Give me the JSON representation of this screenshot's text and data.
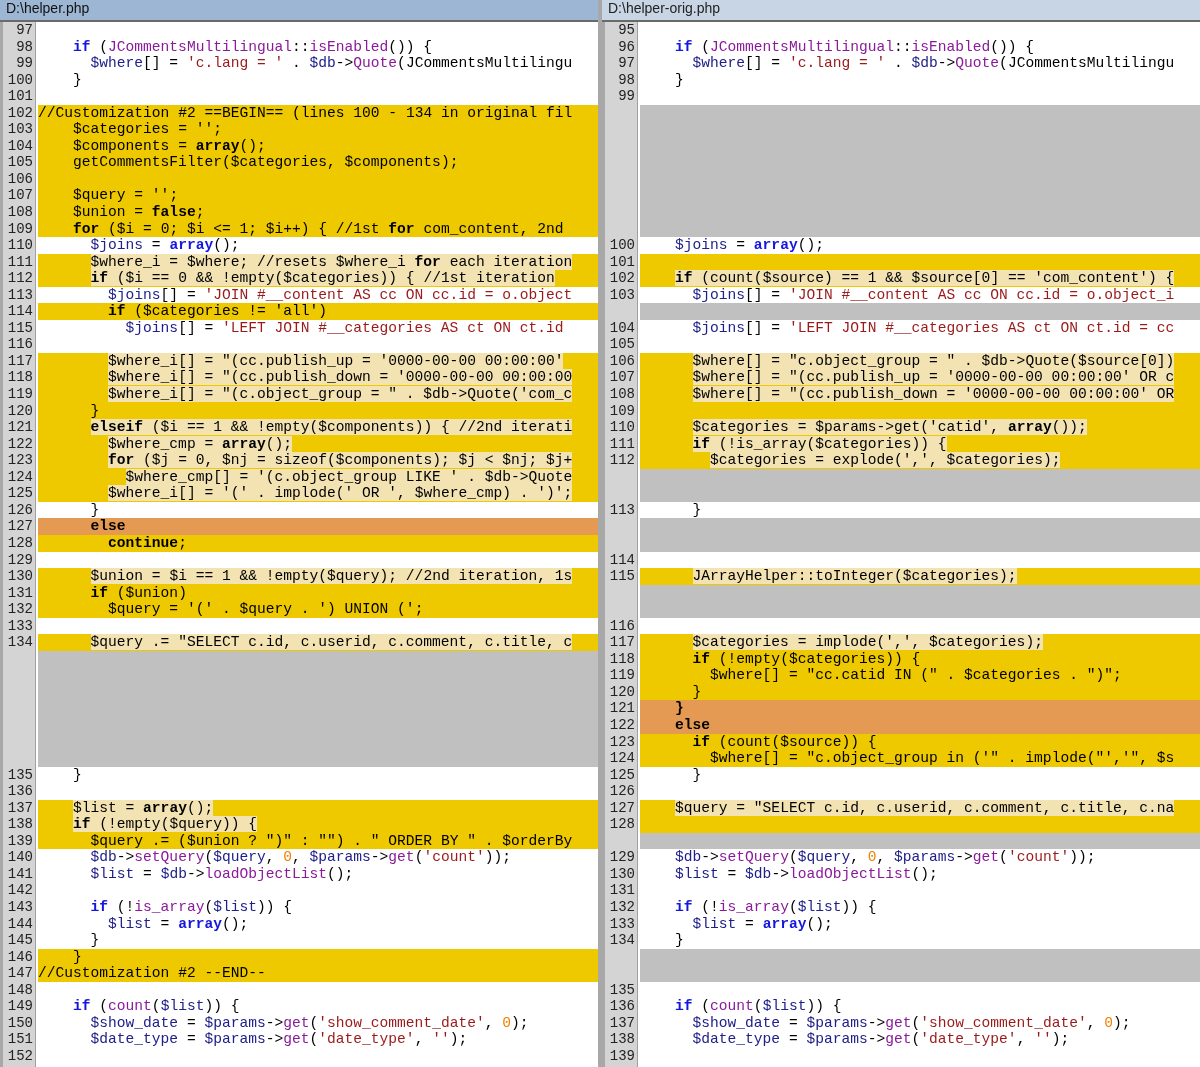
{
  "panes": [
    {
      "title": "D:\\helper.php",
      "active": true,
      "rows": [
        {
          "number": "97",
          "kind": "same"
        },
        {
          "number": "98",
          "kind": "same",
          "text": "    if (JCommentsMultilingual::isEnabled()) {"
        },
        {
          "number": "99",
          "kind": "same",
          "text": "      $where[] = 'c.lang = ' . $db->Quote(JCommentsMultilingu"
        },
        {
          "number": "100",
          "kind": "same",
          "text": "    }"
        },
        {
          "number": "101",
          "kind": "same"
        },
        {
          "number": "102",
          "kind": "changed",
          "text": "//Customization #2 ==BEGIN== (lines 100 - 134 in original fil"
        },
        {
          "number": "103",
          "kind": "changed",
          "text": "    $categories = '';"
        },
        {
          "number": "104",
          "kind": "changed",
          "text": "    $components = array();"
        },
        {
          "number": "105",
          "kind": "changed",
          "text": "    getCommentsFilter($categories, $components);"
        },
        {
          "number": "106",
          "kind": "changed"
        },
        {
          "number": "107",
          "kind": "changed",
          "text": "    $query = '';"
        },
        {
          "number": "108",
          "kind": "changed",
          "text": "    $union = false;"
        },
        {
          "number": "109",
          "kind": "changed",
          "text": "    for ($i = 0; $i <= 1; $i++) { //1st for com_content, 2nd"
        },
        {
          "number": "110",
          "kind": "same",
          "text": "      $joins = array();"
        },
        {
          "number": "111",
          "kind": "changed",
          "marked": true,
          "text": "      $where_i = $where; //resets $where_i for each iteration"
        },
        {
          "number": "112",
          "kind": "changed",
          "marked": true,
          "text": "      if ($i == 0 && !empty($categories)) { //1st iteration"
        },
        {
          "number": "113",
          "kind": "same",
          "text": "        $joins[] = 'JOIN #__content AS cc ON cc.id = o.object"
        },
        {
          "number": "114",
          "kind": "changed",
          "text": "        if ($categories != 'all')"
        },
        {
          "number": "115",
          "kind": "same",
          "text": "          $joins[] = 'LEFT JOIN #__categories AS ct ON ct.id"
        },
        {
          "number": "116",
          "kind": "same"
        },
        {
          "number": "117",
          "kind": "changed",
          "marked": true,
          "text": "        $where_i[] = \"(cc.publish_up = '0000-00-00 00:00:00'"
        },
        {
          "number": "118",
          "kind": "changed",
          "marked": true,
          "text": "        $where_i[] = \"(cc.publish_down = '0000-00-00 00:00:00"
        },
        {
          "number": "119",
          "kind": "changed",
          "marked": true,
          "text": "        $where_i[] = \"(c.object_group = \" . $db->Quote('com_c"
        },
        {
          "number": "120",
          "kind": "changed",
          "text": "      }"
        },
        {
          "number": "121",
          "kind": "changed",
          "marked": true,
          "text": "      elseif ($i == 1 && !empty($components)) { //2nd iterati"
        },
        {
          "number": "122",
          "kind": "changed",
          "marked": true,
          "text": "        $where_cmp = array();"
        },
        {
          "number": "123",
          "kind": "changed",
          "marked": true,
          "text": "        for ($j = 0, $nj = sizeof($components); $j < $nj; $j+"
        },
        {
          "number": "124",
          "kind": "changed",
          "marked": true,
          "text": "          $where_cmp[] = '(c.object_group LIKE ' . $db->Quote"
        },
        {
          "number": "125",
          "kind": "changed",
          "marked": true,
          "text": "        $where_i[] = '(' . implode(' OR ', $where_cmp) . ')';"
        },
        {
          "number": "126",
          "kind": "same",
          "text": "      }"
        },
        {
          "number": "127",
          "kind": "conflict",
          "text": "      else"
        },
        {
          "number": "128",
          "kind": "changed",
          "text": "        continue;"
        },
        {
          "number": "129",
          "kind": "same"
        },
        {
          "number": "130",
          "kind": "changed",
          "marked": true,
          "text": "      $union = $i == 1 && !empty($query); //2nd iteration, 1s"
        },
        {
          "number": "131",
          "kind": "changed",
          "text": "      if ($union)"
        },
        {
          "number": "132",
          "kind": "changed",
          "text": "        $query = '(' . $query . ') UNION (';"
        },
        {
          "number": "133",
          "kind": "same"
        },
        {
          "number": "134",
          "kind": "changed",
          "marked": true,
          "text": "      $query .= \"SELECT c.id, c.userid, c.comment, c.title, c"
        },
        {
          "kind": "filler"
        },
        {
          "kind": "filler"
        },
        {
          "kind": "filler"
        },
        {
          "kind": "filler"
        },
        {
          "kind": "filler"
        },
        {
          "kind": "filler"
        },
        {
          "kind": "filler"
        },
        {
          "number": "135",
          "kind": "same",
          "text": "    }"
        },
        {
          "number": "136",
          "kind": "same"
        },
        {
          "number": "137",
          "kind": "changed",
          "marked": true,
          "text": "    $list = array();"
        },
        {
          "number": "138",
          "kind": "changed",
          "marked": true,
          "text": "    if (!empty($query)) {"
        },
        {
          "number": "139",
          "kind": "changed",
          "text": "      $query .= ($union ? \")\" : \"\") . \" ORDER BY \" . $orderBy"
        },
        {
          "number": "140",
          "kind": "same",
          "text": "      $db->setQuery($query, 0, $params->get('count'));"
        },
        {
          "number": "141",
          "kind": "same",
          "text": "      $list = $db->loadObjectList();"
        },
        {
          "number": "142",
          "kind": "same"
        },
        {
          "number": "143",
          "kind": "same",
          "text": "      if (!is_array($list)) {"
        },
        {
          "number": "144",
          "kind": "same",
          "text": "        $list = array();"
        },
        {
          "number": "145",
          "kind": "same",
          "text": "      }"
        },
        {
          "number": "146",
          "kind": "changed",
          "text": "    }"
        },
        {
          "number": "147",
          "kind": "changed",
          "text": "//Customization #2 --END--"
        },
        {
          "number": "148",
          "kind": "same"
        },
        {
          "number": "149",
          "kind": "same",
          "text": "    if (count($list)) {"
        },
        {
          "number": "150",
          "kind": "same",
          "text": "      $show_date = $params->get('show_comment_date', 0);"
        },
        {
          "number": "151",
          "kind": "same",
          "text": "      $date_type = $params->get('date_type', '');"
        },
        {
          "number": "152",
          "kind": "same"
        }
      ]
    },
    {
      "title": "D:\\helper-orig.php",
      "active": false,
      "rows": [
        {
          "number": "95",
          "kind": "same"
        },
        {
          "number": "96",
          "kind": "same",
          "text": "    if (JCommentsMultilingual::isEnabled()) {"
        },
        {
          "number": "97",
          "kind": "same",
          "text": "      $where[] = 'c.lang = ' . $db->Quote(JCommentsMultilingu"
        },
        {
          "number": "98",
          "kind": "same",
          "text": "    }"
        },
        {
          "number": "99",
          "kind": "same"
        },
        {
          "kind": "filler"
        },
        {
          "kind": "filler"
        },
        {
          "kind": "filler"
        },
        {
          "kind": "filler"
        },
        {
          "kind": "filler"
        },
        {
          "kind": "filler"
        },
        {
          "kind": "filler"
        },
        {
          "kind": "filler"
        },
        {
          "number": "100",
          "kind": "same",
          "text": "    $joins = array();"
        },
        {
          "number": "101",
          "kind": "changed"
        },
        {
          "number": "102",
          "kind": "changed",
          "marked": true,
          "text": "    if (count($source) == 1 && $source[0] == 'com_content') {"
        },
        {
          "number": "103",
          "kind": "same",
          "text": "      $joins[] = 'JOIN #__content AS cc ON cc.id = o.object_i"
        },
        {
          "kind": "filler"
        },
        {
          "number": "104",
          "kind": "same",
          "text": "      $joins[] = 'LEFT JOIN #__categories AS ct ON ct.id = cc"
        },
        {
          "number": "105",
          "kind": "same"
        },
        {
          "number": "106",
          "kind": "changed",
          "marked": true,
          "text": "      $where[] = \"c.object_group = \" . $db->Quote($source[0])"
        },
        {
          "number": "107",
          "kind": "changed",
          "marked": true,
          "text": "      $where[] = \"(cc.publish_up = '0000-00-00 00:00:00' OR c"
        },
        {
          "number": "108",
          "kind": "changed",
          "marked": true,
          "text": "      $where[] = \"(cc.publish_down = '0000-00-00 00:00:00' OR"
        },
        {
          "number": "109",
          "kind": "changed"
        },
        {
          "number": "110",
          "kind": "changed",
          "marked": true,
          "text": "      $categories = $params->get('catid', array());"
        },
        {
          "number": "111",
          "kind": "changed",
          "marked": true,
          "text": "      if (!is_array($categories)) {"
        },
        {
          "number": "112",
          "kind": "changed",
          "marked": true,
          "text": "        $categories = explode(',', $categories);"
        },
        {
          "kind": "filler"
        },
        {
          "kind": "filler"
        },
        {
          "number": "113",
          "kind": "same",
          "text": "      }"
        },
        {
          "kind": "filler"
        },
        {
          "kind": "filler"
        },
        {
          "number": "114",
          "kind": "same"
        },
        {
          "number": "115",
          "kind": "changed",
          "marked": true,
          "text": "      JArrayHelper::toInteger($categories);"
        },
        {
          "kind": "filler"
        },
        {
          "kind": "filler"
        },
        {
          "number": "116",
          "kind": "same"
        },
        {
          "number": "117",
          "kind": "changed",
          "marked": true,
          "text": "      $categories = implode(',', $categories);"
        },
        {
          "number": "118",
          "kind": "changed",
          "text": "      if (!empty($categories)) {"
        },
        {
          "number": "119",
          "kind": "changed",
          "text": "        $where[] = \"cc.catid IN (\" . $categories . \")\";"
        },
        {
          "number": "120",
          "kind": "changed",
          "text": "      }"
        },
        {
          "number": "121",
          "kind": "conflict",
          "text": "    }"
        },
        {
          "number": "122",
          "kind": "conflict",
          "text": "    else"
        },
        {
          "number": "123",
          "kind": "changed",
          "text": "      if (count($source)) {"
        },
        {
          "number": "124",
          "kind": "changed",
          "text": "        $where[] = \"c.object_group in ('\" . implode(\"','\", $s"
        },
        {
          "number": "125",
          "kind": "same",
          "text": "      }"
        },
        {
          "number": "126",
          "kind": "same"
        },
        {
          "number": "127",
          "kind": "changed",
          "marked": true,
          "text": "    $query = \"SELECT c.id, c.userid, c.comment, c.title, c.na"
        },
        {
          "number": "128",
          "kind": "changed"
        },
        {
          "kind": "filler"
        },
        {
          "number": "129",
          "kind": "same",
          "text": "    $db->setQuery($query, 0, $params->get('count'));"
        },
        {
          "number": "130",
          "kind": "same",
          "text": "    $list = $db->loadObjectList();"
        },
        {
          "number": "131",
          "kind": "same"
        },
        {
          "number": "132",
          "kind": "same",
          "text": "    if (!is_array($list)) {"
        },
        {
          "number": "133",
          "kind": "same",
          "text": "      $list = array();"
        },
        {
          "number": "134",
          "kind": "same",
          "text": "    }"
        },
        {
          "kind": "filler"
        },
        {
          "kind": "filler"
        },
        {
          "number": "135",
          "kind": "same"
        },
        {
          "number": "136",
          "kind": "same",
          "text": "    if (count($list)) {"
        },
        {
          "number": "137",
          "kind": "same",
          "text": "      $show_date = $params->get('show_comment_date', 0);"
        },
        {
          "number": "138",
          "kind": "same",
          "text": "      $date_type = $params->get('date_type', '');"
        },
        {
          "number": "139",
          "kind": "same"
        }
      ]
    }
  ]
}
